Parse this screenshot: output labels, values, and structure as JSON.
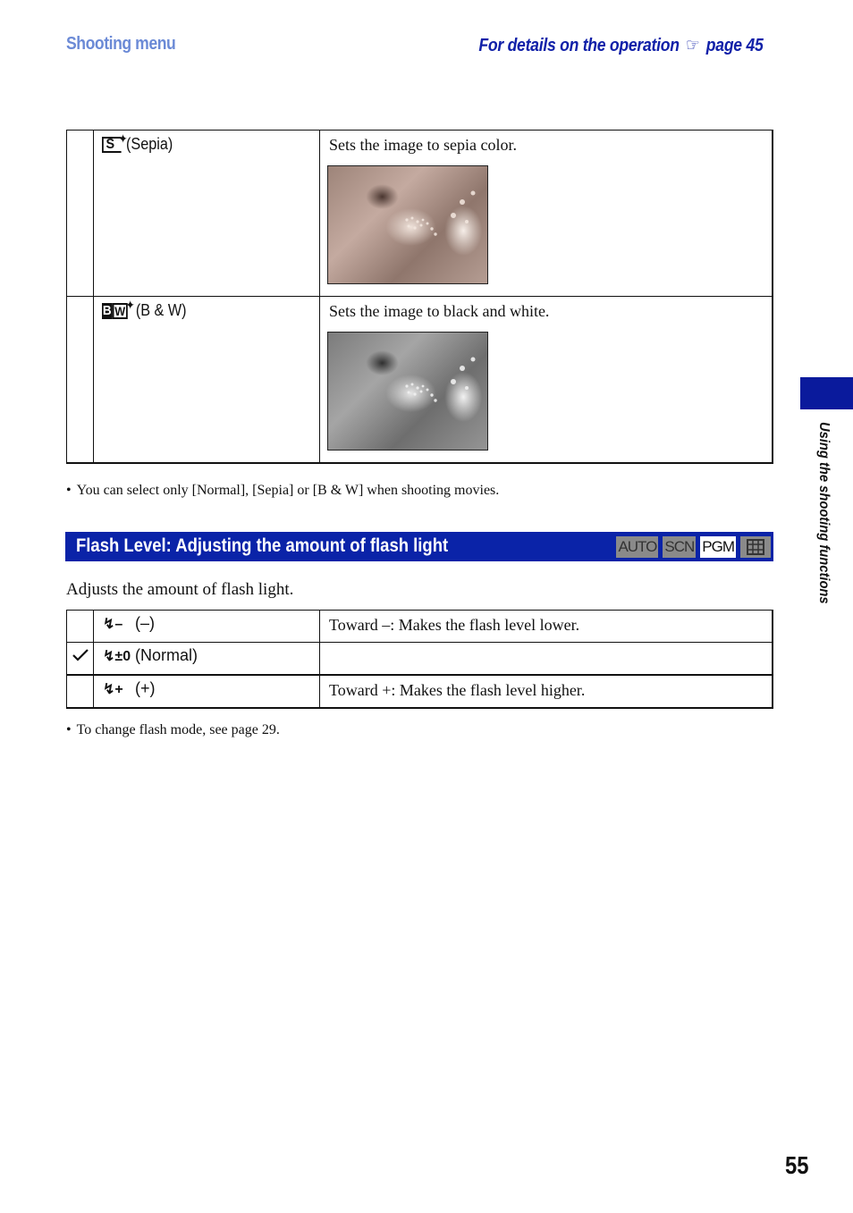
{
  "header": {
    "section": "Shooting menu",
    "details_text": "For details on the operation",
    "hand_icon": "pointing-hand-icon",
    "details_page": "page 45"
  },
  "color_mode_table": {
    "rows": [
      {
        "icon": "sepia-icon",
        "icon_text": "S",
        "label": "(Sepia)",
        "description": "Sets the image to sepia color.",
        "image": "sepia-flower-photo"
      },
      {
        "icon": "bw-icon",
        "icon_text_b": "B",
        "icon_text_w": "W",
        "label": "(B & W)",
        "description": "Sets the image to black and white.",
        "image": "bw-flower-photo"
      }
    ]
  },
  "note1": "You can select only [Normal], [Sepia] or [B & W] when shooting movies.",
  "flash_section": {
    "title": "Flash Level: Adjusting the amount of flash light",
    "modes": [
      {
        "label": "AUTO",
        "active": false
      },
      {
        "label": "SCN",
        "active": false
      },
      {
        "label": "PGM",
        "active": true
      },
      {
        "label": "movie-icon",
        "active": false
      }
    ],
    "intro": "Adjusts the amount of flash light.",
    "rows": [
      {
        "flash_icon": "↯–",
        "label": "(–)",
        "description": "Toward –: Makes the flash level lower.",
        "selected": false
      },
      {
        "flash_icon": "↯±0",
        "label": "(Normal)",
        "description": "",
        "selected": true
      },
      {
        "flash_icon": "↯+",
        "label": "(+)",
        "description": "Toward +: Makes the flash level higher.",
        "selected": false
      }
    ],
    "note": "To change flash mode, see page 29."
  },
  "side_tab": {
    "label": "Using the shooting functions",
    "color": "#0a1a9c"
  },
  "page_number": "55",
  "colors": {
    "header_left": "#6b8ad6",
    "header_right": "#1020a8",
    "section_bar": "#0a23a8"
  }
}
